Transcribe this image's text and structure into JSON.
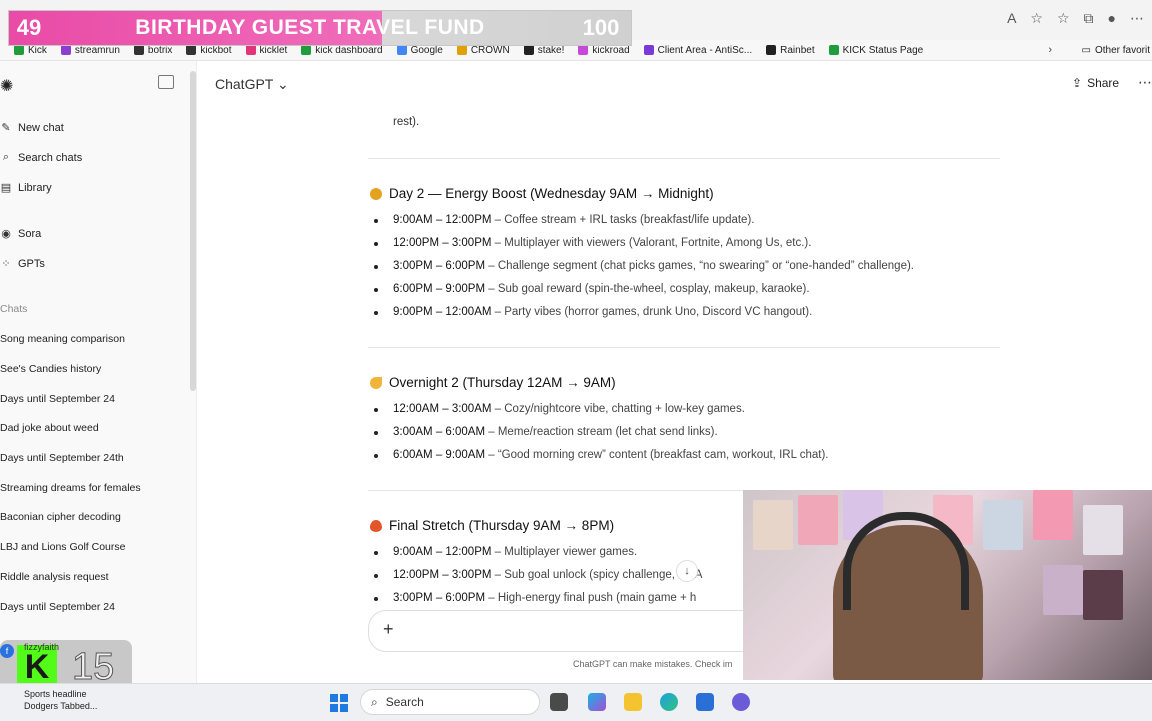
{
  "banner": {
    "left_count": "49",
    "title": "BIRTHDAY GUEST TRAVEL FUND",
    "right_count": "100"
  },
  "bookmarks": [
    {
      "label": "Kick",
      "color": "#1f9d3a"
    },
    {
      "label": "streamrun",
      "color": "#8a3fd1"
    },
    {
      "label": "botrix",
      "color": "#333333"
    },
    {
      "label": "kickbot",
      "color": "#333333"
    },
    {
      "label": "kicklet",
      "color": "#e0357b"
    },
    {
      "label": "kick dashboard",
      "color": "#1f9d3a"
    },
    {
      "label": "Google",
      "color": "#4285f4"
    },
    {
      "label": "CROWN",
      "color": "#e0a100"
    },
    {
      "label": "stake!",
      "color": "#222222"
    },
    {
      "label": "kickroad",
      "color": "#c44ad8"
    },
    {
      "label": "Client Area - AntiSc...",
      "color": "#7a3ad8"
    },
    {
      "label": "Rainbet",
      "color": "#222222"
    },
    {
      "label": "KICK Status Page",
      "color": "#1f9d3a"
    }
  ],
  "bookmarks_other": "Other favorit",
  "sidebar": {
    "nav": [
      {
        "icon": "new-chat-icon",
        "glyph": "✎",
        "label": "New chat"
      },
      {
        "icon": "search-icon",
        "glyph": "⌕",
        "label": "Search chats"
      },
      {
        "icon": "library-icon",
        "glyph": "▤",
        "label": "Library"
      },
      {
        "icon": "sora-icon",
        "glyph": "◉",
        "label": "Sora"
      },
      {
        "icon": "gpts-icon",
        "glyph": "⁘",
        "label": "GPTs"
      }
    ],
    "chats_label": "Chats",
    "chats": [
      "Song meaning comparison",
      "See's Candies history",
      "Days until September 24",
      "Dad joke about weed",
      "Days until September 24th",
      "Streaming dreams for females",
      "Baconian cipher decoding",
      "LBJ and Lions Golf Course",
      "Riddle analysis request",
      "Days until September 24"
    ]
  },
  "header": {
    "model": "ChatGPT ⌄",
    "share": "Share",
    "more": "⋯"
  },
  "content": {
    "rest_text": "rest).",
    "sections": [
      {
        "emoji_color": "#e3a321",
        "title": "Day 2 — Energy Boost (Wednesday 9AM → Midnight)",
        "items": [
          {
            "time": "9:00AM – 12:00PM",
            "desc": " – Coffee stream + IRL tasks (breakfast/life update)."
          },
          {
            "time": "12:00PM – 3:00PM",
            "desc": " – Multiplayer with viewers (Valorant, Fortnite, Among Us, etc.)."
          },
          {
            "time": "3:00PM – 6:00PM",
            "desc": " – Challenge segment (chat picks games, “no swearing” or “one-handed” challenge)."
          },
          {
            "time": "6:00PM – 9:00PM",
            "desc": " – Sub goal reward (spin-the-wheel, cosplay, makeup, karaoke)."
          },
          {
            "time": "9:00PM – 12:00AM",
            "desc": " – Party vibes (horror games, drunk Uno, Discord VC hangout)."
          }
        ]
      },
      {
        "emoji_color": "#f0b43a",
        "title": "Overnight 2 (Thursday 12AM → 9AM)",
        "items": [
          {
            "time": "12:00AM – 3:00AM",
            "desc": " – Cozy/nightcore vibe, chatting + low-key games."
          },
          {
            "time": "3:00AM – 6:00AM",
            "desc": " – Meme/reaction stream (let chat send links)."
          },
          {
            "time": "6:00AM – 9:00AM",
            "desc": " – “Good morning crew” content (breakfast cam, workout, IRL chat)."
          }
        ]
      },
      {
        "emoji_color": "#e2562a",
        "title": "Final Stretch (Thursday 9AM → 8PM)",
        "items": [
          {
            "time": "9:00AM – 12:00PM",
            "desc": " – Multiplayer viewer games."
          },
          {
            "time": "12:00PM – 3:00PM",
            "desc": " – Sub goal unlock (spicy challenge, Q&A"
          },
          {
            "time": "3:00PM – 6:00PM",
            "desc": " – High-energy final push (main game + h"
          }
        ]
      }
    ],
    "composer_plus": "+",
    "disclaimer": "ChatGPT can make mistakes. Check im"
  },
  "kick_overlay": {
    "user": "fizzyfaith",
    "count": "15"
  },
  "taskbar": {
    "news_title": "Sports headline",
    "news_sub": "Dodgers Tabbed...",
    "search": "Search"
  }
}
